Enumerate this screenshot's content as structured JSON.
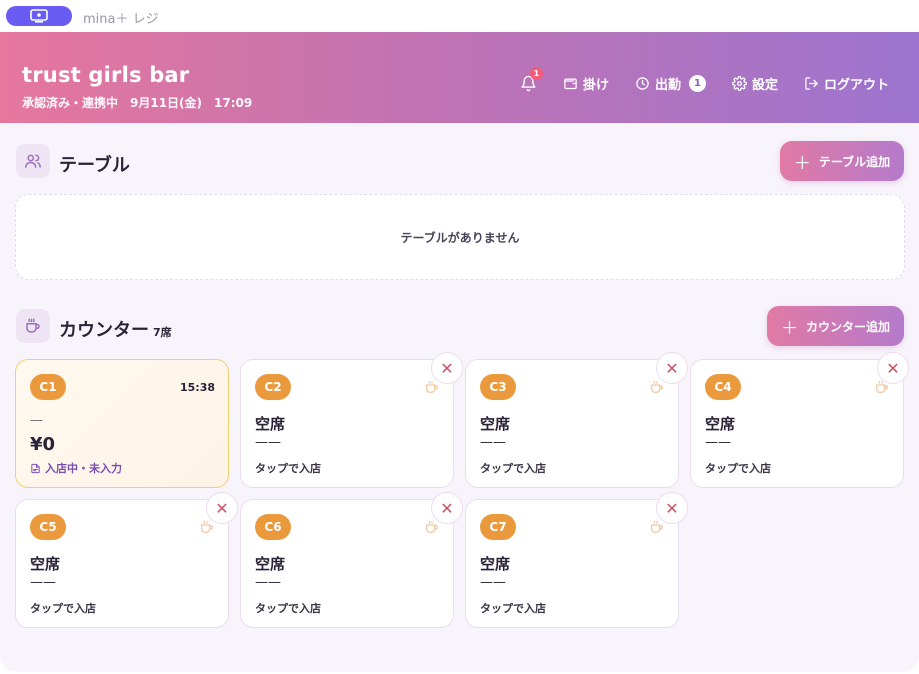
{
  "app": {
    "title": "mina＋ レジ"
  },
  "header": {
    "shop_name": "trust girls bar",
    "status": "承認済み・連携中　9月11日(金)　17:09",
    "bell_badge": "1",
    "nav": {
      "kake": "掛け",
      "shukkin": "出勤",
      "shukkin_count": "1",
      "settings": "設定",
      "logout": "ログアウト"
    }
  },
  "tables": {
    "title": "テーブル",
    "add_label": "テーブル追加",
    "empty_message": "テーブルがありません"
  },
  "counter": {
    "title": "カウンター",
    "count_label": "7席",
    "add_label": "カウンター追加",
    "seats": [
      {
        "id": "C1",
        "active": true,
        "time": "15:38",
        "dash": "—",
        "amount": "¥0",
        "status": "入店中・未入力"
      },
      {
        "id": "C2",
        "active": false,
        "label": "空席",
        "line": "——",
        "hint": "タップで入店"
      },
      {
        "id": "C3",
        "active": false,
        "label": "空席",
        "line": "——",
        "hint": "タップで入店"
      },
      {
        "id": "C4",
        "active": false,
        "label": "空席",
        "line": "——",
        "hint": "タップで入店"
      },
      {
        "id": "C5",
        "active": false,
        "label": "空席",
        "line": "——",
        "hint": "タップで入店"
      },
      {
        "id": "C6",
        "active": false,
        "label": "空席",
        "line": "——",
        "hint": "タップで入店"
      },
      {
        "id": "C7",
        "active": false,
        "label": "空席",
        "line": "——",
        "hint": "タップで入店"
      }
    ]
  },
  "icons": {
    "app": "register-icon",
    "bell": "bell-icon",
    "wallet": "wallet-icon",
    "clock": "clock-icon",
    "gear": "gear-icon",
    "logout": "logout-icon",
    "users": "users-icon",
    "cup": "coffee-cup-icon",
    "close": "close-icon",
    "document": "document-icon"
  },
  "colors": {
    "accent": "#6a5cf2",
    "header_start": "#e6779d",
    "header_end": "#9d74cf",
    "seat_badge": "#ea9a3c",
    "active_border": "#f3cf72"
  }
}
